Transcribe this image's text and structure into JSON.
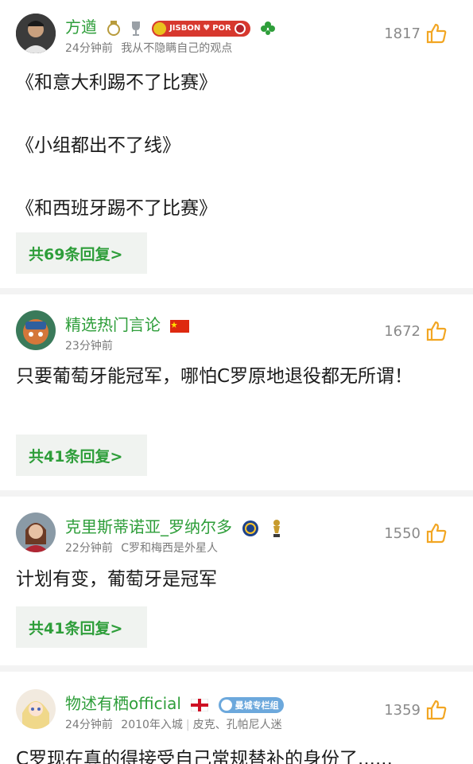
{
  "comments": [
    {
      "username": "方遒",
      "time": "24分钟前",
      "signature": "我从不隐瞒自己的观点",
      "likes": "1817",
      "badges": {
        "pill_text_1": "JISBON",
        "pill_text_2": "POR"
      },
      "lines": [
        "《和意大利踢不了比赛》",
        "《小组都出不了线》",
        "《和西班牙踢不了比赛》"
      ],
      "reply_label": "共69条回复>",
      "icons": [
        "real-madrid-crest-icon",
        "trophy-icon",
        "sporting-lisbon-badge-icon",
        "clover-icon"
      ]
    },
    {
      "username": "精选热门言论",
      "time": "23分钟前",
      "likes": "1672",
      "text": "只要葡萄牙能冠军，哪怕C罗原地退役都无所谓！",
      "reply_label": "共41条回复>",
      "icons": [
        "china-flag-icon"
      ]
    },
    {
      "username": "克里斯蒂诺亚_罗纳尔多",
      "time": "22分钟前",
      "signature": "C罗和梅西是外星人",
      "likes": "1550",
      "text": "计划有变，葡萄牙是冠军",
      "reply_label": "共41条回复>",
      "icons": [
        "warriors-badge-icon",
        "trophy-icon"
      ]
    },
    {
      "username": "物述有栖official",
      "time": "24分钟前",
      "signature_parts": [
        "2010年入城",
        "皮克、孔帕尼人迷"
      ],
      "tag": "曼城专栏组",
      "likes": "1359",
      "text": "C罗现在真的得接受自己常规替补的身份了......",
      "icons": [
        "england-flag-icon",
        "man-city-badge-icon"
      ]
    }
  ],
  "colors": {
    "username": "#2e9e3a",
    "reply_text": "#2e9e3a",
    "thumb": "#f2a623",
    "meta": "#7a7a7a"
  }
}
